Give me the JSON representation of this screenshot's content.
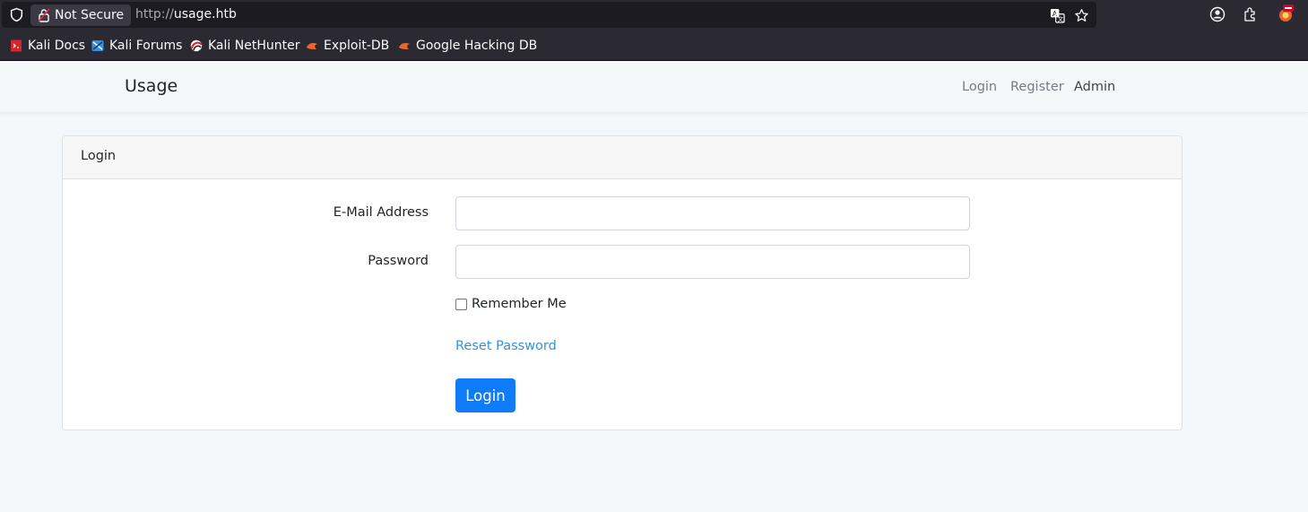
{
  "browser": {
    "security_label": "Not Secure",
    "url_protocol": "http://",
    "url_host": "usage.htb",
    "bookmarks": [
      {
        "label": "Kali Docs",
        "icon": "kali-docs-icon"
      },
      {
        "label": "Kali Forums",
        "icon": "kali-forums-icon"
      },
      {
        "label": "Kali NetHunter",
        "icon": "kali-nethunter-icon"
      },
      {
        "label": "Exploit-DB",
        "icon": "exploit-db-icon"
      },
      {
        "label": "Google Hacking DB",
        "icon": "google-hacking-db-icon"
      }
    ]
  },
  "navbar": {
    "brand": "Usage",
    "links": [
      {
        "label": "Login"
      },
      {
        "label": "Register"
      },
      {
        "label": "Admin"
      }
    ]
  },
  "login_card": {
    "header": "Login",
    "email_label": "E-Mail Address",
    "email_value": "",
    "password_label": "Password",
    "password_value": "",
    "remember_label": "Remember Me",
    "remember_checked": false,
    "reset_label": "Reset Password",
    "submit_label": "Login"
  },
  "colors": {
    "primary_button": "#0e7cf8",
    "link": "#3490dc",
    "page_background": "#f5f8fa"
  }
}
